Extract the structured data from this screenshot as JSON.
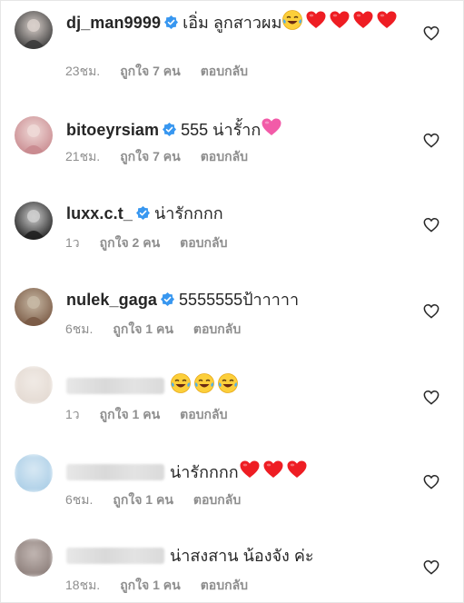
{
  "comments": [
    {
      "username": "dj_man9999",
      "verified": true,
      "text": "เอิ่ม ลูกสาวผม",
      "emojis": [
        "joy",
        "heart",
        "heart",
        "heart",
        "heart"
      ],
      "time": "23ชม.",
      "likes": "ถูกใจ 7 คน",
      "reply": "ตอบกลับ",
      "avatar_colors": [
        "#3a3a3a",
        "#d9d0cb"
      ]
    },
    {
      "username": "bitoeyrsiam",
      "verified": true,
      "text": "555 น่ารั้าก",
      "emojis": [
        "pink-heart"
      ],
      "time": "21ชม.",
      "likes": "ถูกใจ 7 คน",
      "reply": "ตอบกลับ",
      "avatar_colors": [
        "#c98a8f",
        "#efd9d7"
      ]
    },
    {
      "username": "luxx.c.t_",
      "verified": true,
      "text": "น่ารักกกก",
      "emojis": [],
      "time": "1ว",
      "likes": "ถูกใจ 2 คน",
      "reply": "ตอบกลับ",
      "avatar_colors": [
        "#1f1f1f",
        "#cfcfcf"
      ]
    },
    {
      "username": "nulek_gaga",
      "verified": true,
      "text": "5555555ป้าาาาา",
      "emojis": [],
      "time": "6ชม.",
      "likes": "ถูกใจ 1 คน",
      "reply": "ตอบกลับ",
      "avatar_colors": [
        "#7a5a45",
        "#c7b8a4"
      ]
    },
    {
      "username": "",
      "verified": false,
      "text": "",
      "emojis": [
        "joy",
        "joy",
        "joy"
      ],
      "time": "1ว",
      "likes": "ถูกใจ 1 คน",
      "reply": "ตอบกลับ",
      "avatar_colors": [
        "#e3d9d1",
        "#f1ebe6"
      ]
    },
    {
      "username": "",
      "verified": false,
      "text": "น่ารักกกก",
      "emojis": [
        "heart",
        "heart",
        "heart"
      ],
      "time": "6ชม.",
      "likes": "ถูกใจ 1 คน",
      "reply": "ตอบกลับ",
      "avatar_colors": [
        "#a9cde6",
        "#d9e9f4"
      ]
    },
    {
      "username": "",
      "verified": false,
      "text": "น่าสงสาน น้องจัง ค่ะ",
      "emojis": [],
      "time": "18ชม.",
      "likes": "ถูกใจ 1 คน",
      "reply": "ตอบกลับ",
      "avatar_colors": [
        "#8a7c78",
        "#c3b8b4"
      ]
    }
  ],
  "icons": {
    "verified": "verified-badge-icon",
    "like": "heart-outline-icon"
  },
  "colors": {
    "verified": "#3897f0",
    "meta": "#8e8e8e",
    "text": "#262626",
    "emoji_heart": "#ee1d23",
    "emoji_pink_heart": "#f25ba8"
  }
}
